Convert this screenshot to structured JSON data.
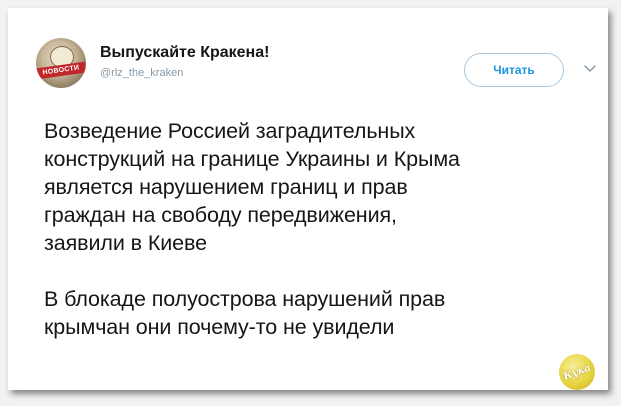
{
  "profile": {
    "display_name": "Выпускайте Кракена!",
    "handle": "@rlz_the_kraken",
    "avatar_caption": "НОВОСТИ"
  },
  "actions": {
    "follow_label": "Читать",
    "menu_icon": "chevron-down-icon"
  },
  "tweet": {
    "text": "Возведение Россией заградительных\nконструкций на границе Украины и Крыма\nявляется нарушением границ и прав\nграждан на свободу передвижения,\nзаявили в Киеве\n\nВ блокаде полуострова нарушений прав\nкрымчан они почему-то не увидели"
  },
  "watermark": {
    "text": "Кука"
  },
  "colors": {
    "accent": "#1b95e0",
    "text": "#14171a",
    "muted": "#8899a6",
    "follow_border": "#a9c7dc"
  }
}
